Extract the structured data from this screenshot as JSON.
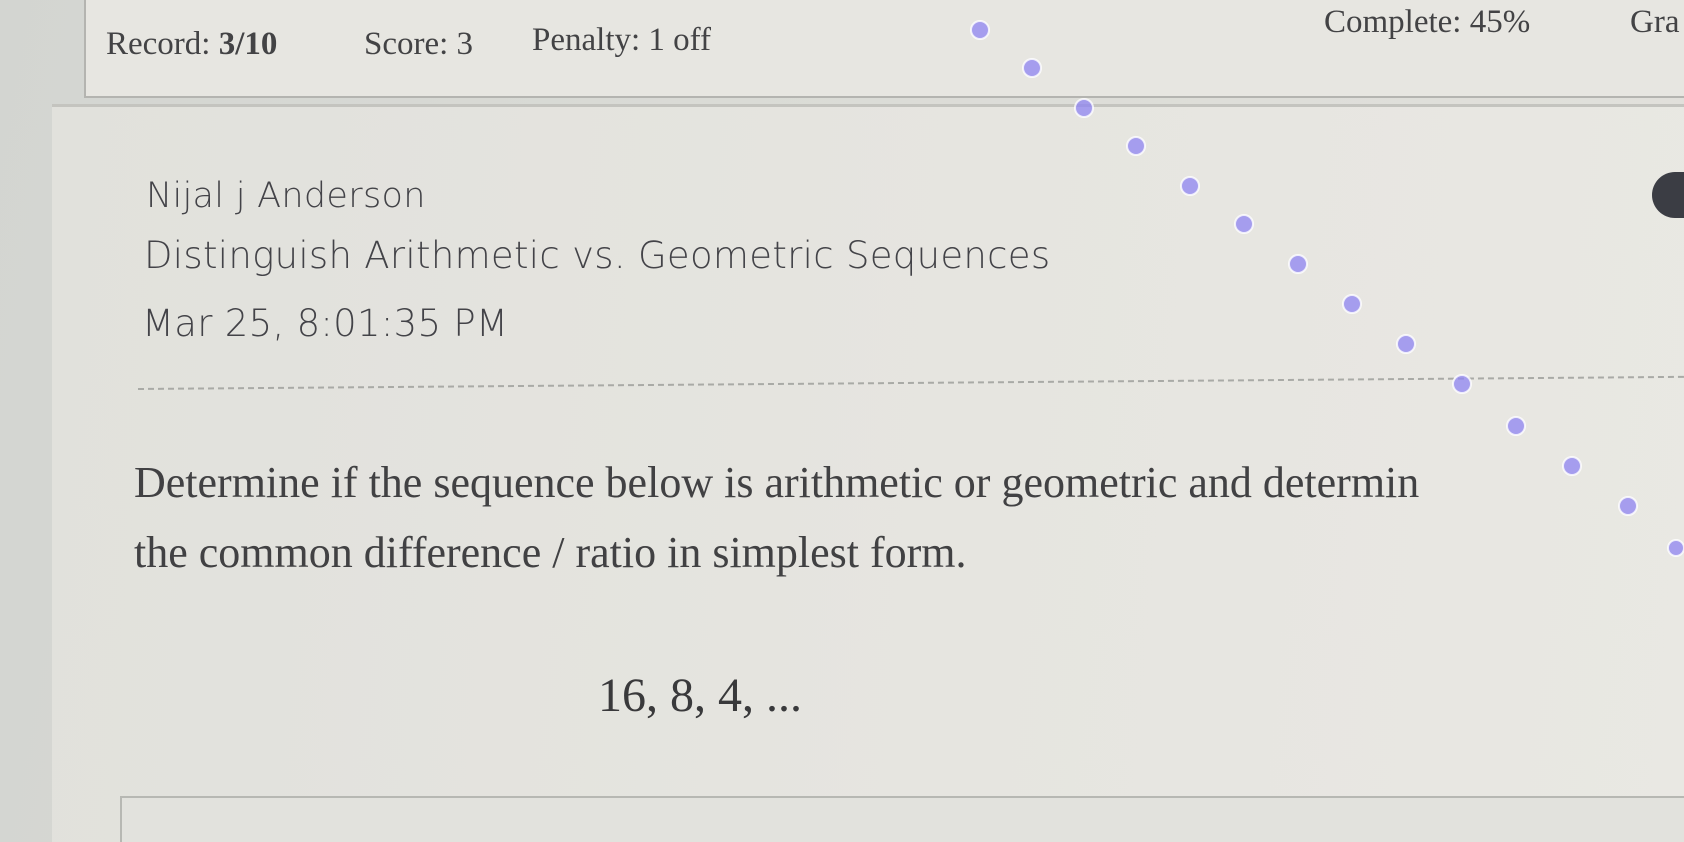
{
  "status_bar": {
    "record_label": "Record:",
    "record_value": "3/10",
    "score": "Score: 3",
    "penalty": "Penalty: 1 off",
    "complete": "Complete: 45%",
    "grade_partial": "Gra"
  },
  "assignment": {
    "student_name": "Nijal j Anderson",
    "topic": "Distinguish Arithmetic vs. Geometric Sequences",
    "timestamp": "Mar 25, 8:01:35 PM"
  },
  "question": {
    "line1": "Determine if the sequence below is arithmetic or geometric and determin",
    "line2": "the common difference / ratio in simplest form.",
    "sequence": "16, 8, 4, ..."
  },
  "colors": {
    "background": "#dadbd6",
    "text": "#414143",
    "moire_dots": "#7d6ff0"
  }
}
